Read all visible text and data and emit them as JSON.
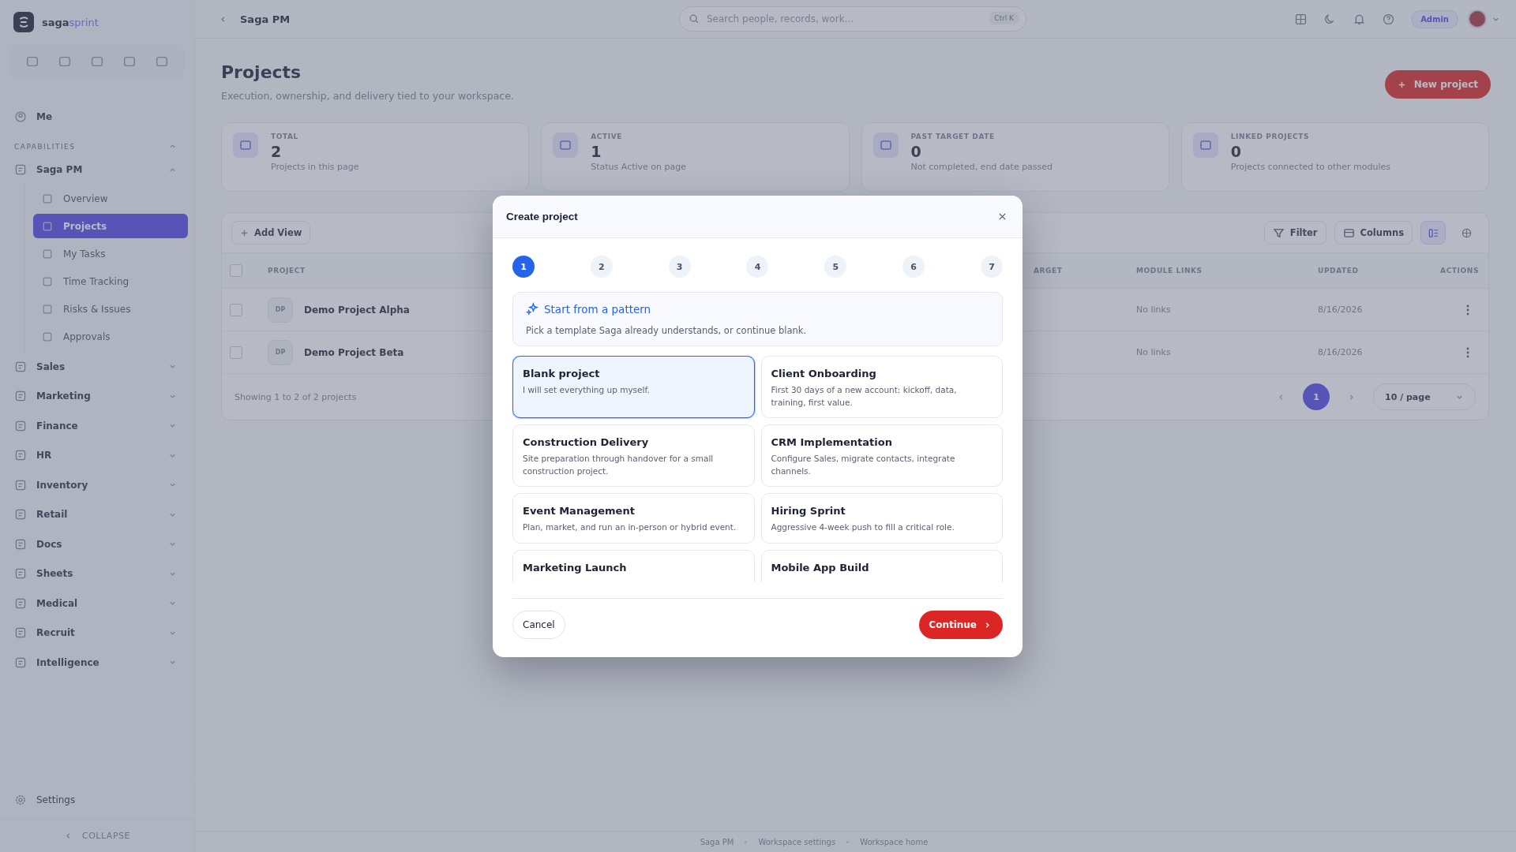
{
  "brand": {
    "name": "saga",
    "suffix": "sprint"
  },
  "sidebar": {
    "me": "Me",
    "section_label": "CAPABILITIES",
    "section_expanded": true,
    "groups": [
      {
        "label": "Saga PM",
        "expanded": true,
        "children": [
          {
            "label": "Overview",
            "selected": false
          },
          {
            "label": "Projects",
            "selected": true
          },
          {
            "label": "My Tasks",
            "selected": false
          },
          {
            "label": "Time Tracking",
            "selected": false
          },
          {
            "label": "Risks & Issues",
            "selected": false
          },
          {
            "label": "Approvals",
            "selected": false
          }
        ]
      },
      {
        "label": "Sales",
        "expanded": false
      },
      {
        "label": "Marketing",
        "expanded": false
      },
      {
        "label": "Finance",
        "expanded": false
      },
      {
        "label": "HR",
        "expanded": false
      },
      {
        "label": "Inventory",
        "expanded": false
      },
      {
        "label": "Retail",
        "expanded": false
      },
      {
        "label": "Docs",
        "expanded": false
      },
      {
        "label": "Sheets",
        "expanded": false
      },
      {
        "label": "Medical",
        "expanded": false
      },
      {
        "label": "Recruit",
        "expanded": false
      },
      {
        "label": "Intelligence",
        "expanded": false
      }
    ],
    "settings": "Settings",
    "collapse": "COLLAPSE"
  },
  "topbar": {
    "breadcrumb": "Saga PM",
    "search": {
      "placeholder": "Search people, records, work..."
    },
    "shortcut": "Ctrl K",
    "role": "Admin"
  },
  "page": {
    "title": "Projects",
    "subtitle": "Execution, ownership, and delivery tied to your workspace.",
    "new_button": "New project",
    "stats": [
      {
        "label": "TOTAL",
        "value": "2",
        "note": "Projects in this page"
      },
      {
        "label": "ACTIVE",
        "value": "1",
        "note": "Status Active on page"
      },
      {
        "label": "PAST TARGET DATE",
        "value": "0",
        "note": "Not completed, end date passed"
      },
      {
        "label": "LINKED PROJECTS",
        "value": "0",
        "note": "Projects connected to other modules"
      }
    ]
  },
  "table": {
    "add_view": "Add View",
    "filter": "Filter",
    "columns_button": "Columns",
    "views": [
      {
        "kind": "list",
        "selected": true
      },
      {
        "kind": "grid",
        "selected": false
      }
    ],
    "select_all": {
      "checked": false
    },
    "columns": [
      "PROJECT",
      "ARGET",
      "MODULE LINKS",
      "UPDATED",
      "ACTIONS"
    ],
    "rows": [
      {
        "checked": false,
        "initials": "DP",
        "name": "Demo Project Alpha",
        "module_links": "No links",
        "updated": "8/16/2026"
      },
      {
        "checked": false,
        "initials": "DP",
        "name": "Demo Project Beta",
        "module_links": "No links",
        "updated": "8/16/2026"
      }
    ],
    "summary": "Showing 1 to 2 of 2 projects",
    "pages": [
      {
        "label": "1",
        "selected": true
      }
    ],
    "page_size": "10 / page"
  },
  "footer": [
    "Saga PM",
    "Workspace settings",
    "Workspace home"
  ],
  "modal": {
    "title": "Create project",
    "steps": [
      {
        "label": "1",
        "selected": true
      },
      {
        "label": "2",
        "selected": false
      },
      {
        "label": "3",
        "selected": false
      },
      {
        "label": "4",
        "selected": false
      },
      {
        "label": "5",
        "selected": false
      },
      {
        "label": "6",
        "selected": false
      },
      {
        "label": "7",
        "selected": false
      }
    ],
    "banner": {
      "title": "Start from a pattern",
      "text": "Pick a template Saga already understands, or continue blank."
    },
    "templates": [
      {
        "title": "Blank project",
        "description": "I will set everything up myself.",
        "selected": true
      },
      {
        "title": "Client Onboarding",
        "description": "First 30 days of a new account: kickoff, data, training, first value.",
        "selected": false
      },
      {
        "title": "Construction Delivery",
        "description": "Site preparation through handover for a small construction project.",
        "selected": false
      },
      {
        "title": "CRM Implementation",
        "description": "Configure Sales, migrate contacts, integrate channels.",
        "selected": false
      },
      {
        "title": "Event Management",
        "description": "Plan, market, and run an in-person or hybrid event.",
        "selected": false
      },
      {
        "title": "Hiring Sprint",
        "description": "Aggressive 4-week push to fill a critical role.",
        "selected": false
      },
      {
        "title": "Marketing Launch",
        "selected": false
      },
      {
        "title": "Mobile App Build",
        "selected": false
      }
    ],
    "cancel": "Cancel",
    "continue": "Continue"
  }
}
